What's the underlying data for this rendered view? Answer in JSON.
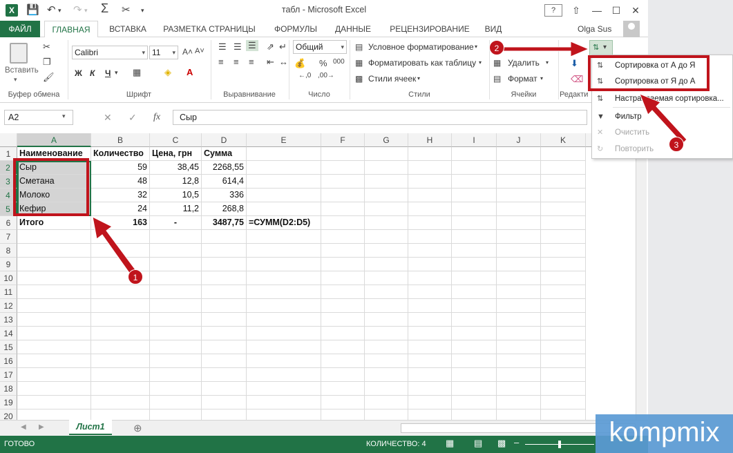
{
  "app": {
    "title": "табл - Microsoft Excel",
    "logo": "X"
  },
  "ribbon_tabs": [
    "ФАЙЛ",
    "ГЛАВНАЯ",
    "ВСТАВКА",
    "РАЗМЕТКА СТРАНИЦЫ",
    "ФОРМУЛЫ",
    "ДАННЫЕ",
    "РЕЦЕНЗИРОВАНИЕ",
    "ВИД"
  ],
  "user": "Olga Sus",
  "ribbon": {
    "paste_label": "Вставить",
    "font_name": "Calibri",
    "font_size": "11",
    "bold": "Ж",
    "italic": "К",
    "underline": "Ч",
    "number_format": "Общий",
    "styles": {
      "conditional": "Условное форматирование",
      "as_table": "Форматировать как таблицу",
      "cell_styles": "Стили ячеек"
    },
    "cells": {
      "delete": "Удалить",
      "format": "Формат"
    },
    "groups": {
      "clipboard": "Буфер обмена",
      "font": "Шрифт",
      "alignment": "Выравнивание",
      "number": "Число",
      "styles": "Стили",
      "cells": "Ячейки",
      "editing": "Редакти"
    }
  },
  "formula_bar": {
    "name_box": "A2",
    "fx": "fx",
    "content": "Сыр"
  },
  "columns": [
    "A",
    "B",
    "C",
    "D",
    "E",
    "F",
    "G",
    "H",
    "I",
    "J",
    "K"
  ],
  "rows": [
    "1",
    "2",
    "3",
    "4",
    "5",
    "6",
    "7",
    "8",
    "9",
    "10",
    "11",
    "12",
    "13",
    "14",
    "15",
    "16",
    "17",
    "18",
    "19",
    "20"
  ],
  "table": {
    "header": [
      "Наименование",
      "Количество",
      "Цена, грн",
      "Сумма"
    ],
    "data": [
      [
        "Сыр",
        "59",
        "38,45",
        "2268,55"
      ],
      [
        "Сметана",
        "48",
        "12,8",
        "614,4"
      ],
      [
        "Молоко",
        "32",
        "10,5",
        "336"
      ],
      [
        "Кефир",
        "24",
        "11,2",
        "268,8"
      ]
    ],
    "total": [
      "Итого",
      "163",
      "-",
      "3487,75",
      "=СУММ(D2:D5)"
    ]
  },
  "sort_menu": {
    "items": [
      {
        "label": "Сортировка от А до Я",
        "icon": "sort-az-icon",
        "enabled": true
      },
      {
        "label": "Сортировка от Я до А",
        "icon": "sort-za-icon",
        "enabled": true
      },
      {
        "label": "Настраиваемая сортировка...",
        "icon": "custom-sort-icon",
        "enabled": true
      },
      {
        "label": "Фильтр",
        "icon": "filter-icon",
        "enabled": true
      },
      {
        "label": "Очистить",
        "icon": "clear-filter-icon",
        "enabled": false
      },
      {
        "label": "Повторить",
        "icon": "reapply-icon",
        "enabled": false
      }
    ]
  },
  "sheet": {
    "name": "Лист1"
  },
  "status": {
    "ready": "ГОТОВО",
    "count": "КОЛИЧЕСТВО: 4",
    "zoom": "100%"
  },
  "annotations": {
    "badge1": "1",
    "badge2": "2",
    "badge3": "3"
  },
  "watermark": "kompmix",
  "colors": {
    "excel_green": "#217346",
    "annotation_red": "#c0141c"
  }
}
